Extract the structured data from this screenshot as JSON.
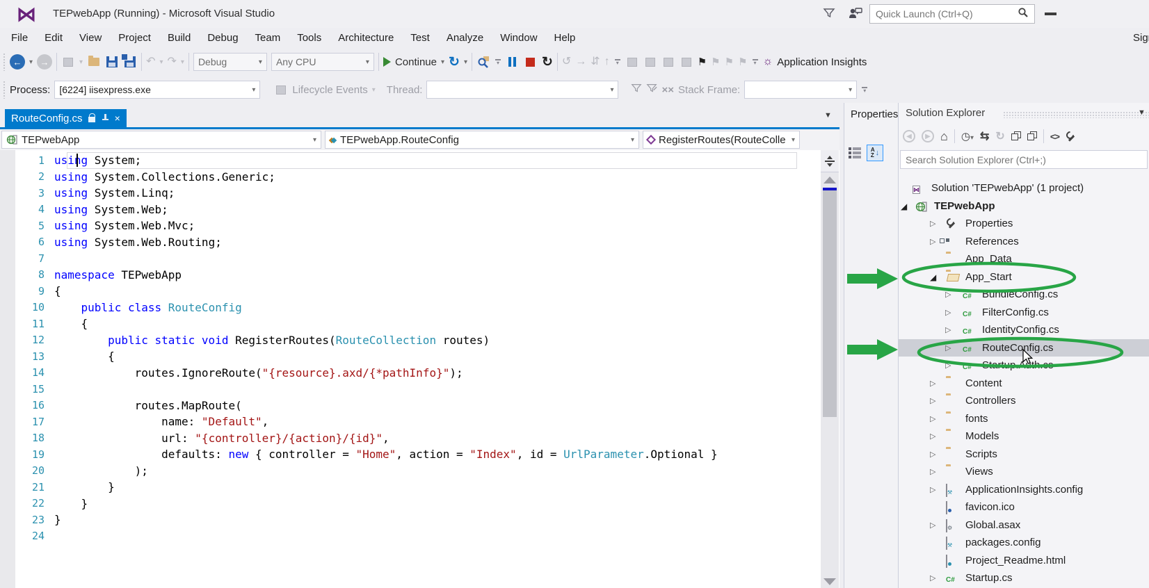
{
  "colors": {
    "accent": "#007acc",
    "annotation": "#28a546",
    "keyword": "#0000ff",
    "type": "#2b91af",
    "string": "#a31515",
    "selection": "#cccedb",
    "folder": "#dcb67a"
  },
  "window": {
    "title": "TEPwebApp (Running) - Microsoft Visual Studio",
    "quick_launch_placeholder": "Quick Launch (Ctrl+Q)",
    "sign_in": "Sign"
  },
  "menu": [
    "File",
    "Edit",
    "View",
    "Project",
    "Build",
    "Debug",
    "Team",
    "Tools",
    "Architecture",
    "Test",
    "Analyze",
    "Window",
    "Help"
  ],
  "toolbar": {
    "debug_config": "Debug",
    "platform": "Any CPU",
    "continue_label": "Continue",
    "app_insights_label": "Application Insights"
  },
  "debug_location": {
    "process_label": "Process:",
    "process_value": "[6224] iisexpress.exe",
    "lifecycle_label": "Lifecycle Events",
    "thread_label": "Thread:",
    "stack_frame_label": "Stack Frame:"
  },
  "editor": {
    "tab_title": "RouteConfig.cs",
    "nav_project": "TEPwebApp",
    "nav_type": "TEPwebApp.RouteConfig",
    "nav_member": "RegisterRoutes(RouteColle",
    "code": [
      [
        [
          "k",
          "using"
        ],
        [
          "p",
          " System;"
        ]
      ],
      [
        [
          "k",
          "using"
        ],
        [
          "p",
          " System.Collections.Generic;"
        ]
      ],
      [
        [
          "k",
          "using"
        ],
        [
          "p",
          " System.Linq;"
        ]
      ],
      [
        [
          "k",
          "using"
        ],
        [
          "p",
          " System.Web;"
        ]
      ],
      [
        [
          "k",
          "using"
        ],
        [
          "p",
          " System.Web.Mvc;"
        ]
      ],
      [
        [
          "k",
          "using"
        ],
        [
          "p",
          " System.Web.Routing;"
        ]
      ],
      [],
      [
        [
          "k",
          "namespace"
        ],
        [
          "p",
          " TEPwebApp"
        ]
      ],
      [
        [
          "p",
          "{"
        ]
      ],
      [
        [
          "p",
          "    "
        ],
        [
          "k",
          "public class"
        ],
        [
          "p",
          " "
        ],
        [
          "t",
          "RouteConfig"
        ]
      ],
      [
        [
          "p",
          "    {"
        ]
      ],
      [
        [
          "p",
          "        "
        ],
        [
          "k",
          "public static void"
        ],
        [
          "p",
          " RegisterRoutes("
        ],
        [
          "t",
          "RouteCollection"
        ],
        [
          "p",
          " routes)"
        ]
      ],
      [
        [
          "p",
          "        {"
        ]
      ],
      [
        [
          "p",
          "            routes.IgnoreRoute("
        ],
        [
          "s",
          "\"{resource}.axd/{*pathInfo}\""
        ],
        [
          "p",
          ");"
        ]
      ],
      [],
      [
        [
          "p",
          "            routes.MapRoute("
        ]
      ],
      [
        [
          "p",
          "                name: "
        ],
        [
          "s",
          "\"Default\""
        ],
        [
          "p",
          ","
        ]
      ],
      [
        [
          "p",
          "                url: "
        ],
        [
          "s",
          "\"{controller}/{action}/{id}\""
        ],
        [
          "p",
          ","
        ]
      ],
      [
        [
          "p",
          "                defaults: "
        ],
        [
          "k",
          "new"
        ],
        [
          "p",
          " { controller = "
        ],
        [
          "s",
          "\"Home\""
        ],
        [
          "p",
          ", action = "
        ],
        [
          "s",
          "\"Index\""
        ],
        [
          "p",
          ", id = "
        ],
        [
          "t",
          "UrlParameter"
        ],
        [
          "p",
          ".Optional }"
        ]
      ],
      [
        [
          "p",
          "            );"
        ]
      ],
      [
        [
          "p",
          "        }"
        ]
      ],
      [
        [
          "p",
          "    }"
        ]
      ],
      [
        [
          "p",
          "}"
        ]
      ],
      []
    ]
  },
  "properties_panel": {
    "title": "Properties"
  },
  "solution_explorer": {
    "title": "Solution Explorer",
    "search_placeholder": "Search Solution Explorer (Ctrl+;)",
    "tree": [
      {
        "label": "Solution 'TEPwebApp' (1 project)",
        "icon": "solution",
        "level": 0,
        "expander": "none"
      },
      {
        "label": "TEPwebApp",
        "icon": "project",
        "level": 1,
        "expander": "expanded",
        "bold": true
      },
      {
        "label": "Properties",
        "icon": "wrench",
        "level": 2,
        "expander": "collapsed"
      },
      {
        "label": "References",
        "icon": "references",
        "level": 2,
        "expander": "collapsed"
      },
      {
        "label": "App_Data",
        "icon": "folder",
        "level": 2,
        "expander": "none"
      },
      {
        "label": "App_Start",
        "icon": "folder-open",
        "level": 2,
        "expander": "expanded"
      },
      {
        "label": "BundleConfig.cs",
        "icon": "csharp",
        "level": 3,
        "expander": "collapsed"
      },
      {
        "label": "FilterConfig.cs",
        "icon": "csharp",
        "level": 3,
        "expander": "collapsed"
      },
      {
        "label": "IdentityConfig.cs",
        "icon": "csharp",
        "level": 3,
        "expander": "collapsed"
      },
      {
        "label": "RouteConfig.cs",
        "icon": "csharp",
        "level": 3,
        "expander": "collapsed",
        "selected": true
      },
      {
        "label": "Startup.Auth.cs",
        "icon": "csharp",
        "level": 3,
        "expander": "collapsed"
      },
      {
        "label": "Content",
        "icon": "folder",
        "level": 2,
        "expander": "collapsed"
      },
      {
        "label": "Controllers",
        "icon": "folder",
        "level": 2,
        "expander": "collapsed"
      },
      {
        "label": "fonts",
        "icon": "folder",
        "level": 2,
        "expander": "collapsed"
      },
      {
        "label": "Models",
        "icon": "folder",
        "level": 2,
        "expander": "collapsed"
      },
      {
        "label": "Scripts",
        "icon": "folder",
        "level": 2,
        "expander": "collapsed"
      },
      {
        "label": "Views",
        "icon": "folder",
        "level": 2,
        "expander": "collapsed"
      },
      {
        "label": "ApplicationInsights.config",
        "icon": "config",
        "level": 2,
        "expander": "collapsed"
      },
      {
        "label": "favicon.ico",
        "icon": "image",
        "level": 2,
        "expander": "none"
      },
      {
        "label": "Global.asax",
        "icon": "asax",
        "level": 2,
        "expander": "collapsed"
      },
      {
        "label": "packages.config",
        "icon": "config",
        "level": 2,
        "expander": "none"
      },
      {
        "label": "Project_Readme.html",
        "icon": "html",
        "level": 2,
        "expander": "none"
      },
      {
        "label": "Startup.cs",
        "icon": "csharp",
        "level": 2,
        "expander": "collapsed"
      }
    ]
  }
}
